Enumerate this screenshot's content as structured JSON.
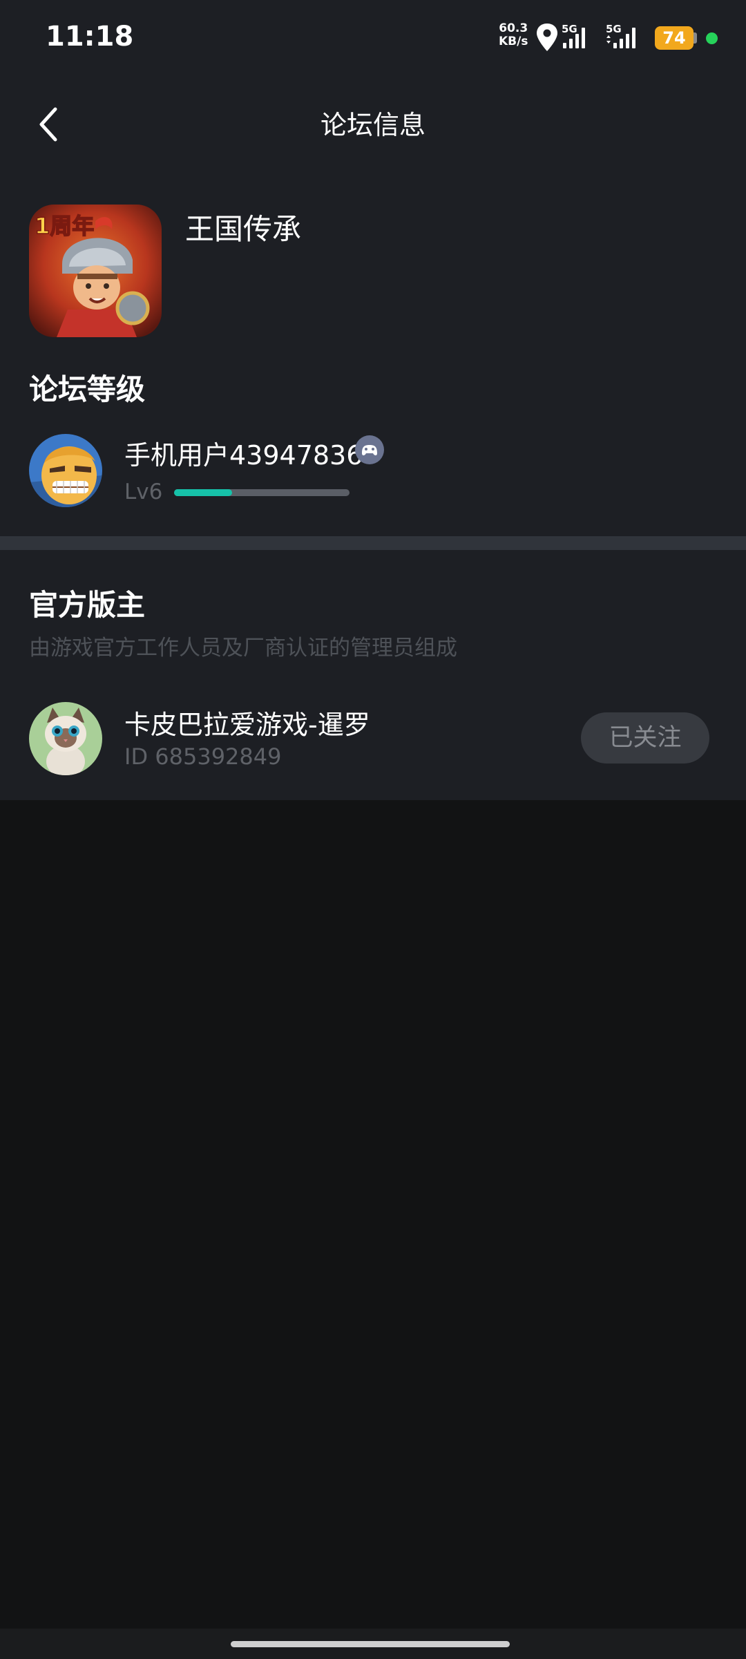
{
  "status_bar": {
    "time": "11:18",
    "net_speed_value": "60.3",
    "net_speed_unit": "KB/s",
    "signal1": "5G",
    "signal2": "5G",
    "battery": "74"
  },
  "header": {
    "title": "论坛信息"
  },
  "game": {
    "name": "王国传承",
    "icon_badge": "1周年"
  },
  "forum_level": {
    "section_title": "论坛等级",
    "user_name": "手机用户43947836",
    "level": "Lv6",
    "progress": 0.33
  },
  "moderators": {
    "section_title": "官方版主",
    "subtitle": "由游戏官方工作人员及厂商认证的管理员组成",
    "items": [
      {
        "name": "卡皮巴拉爱游戏-暹罗",
        "id": "ID 685392849",
        "follow_label": "已关注"
      }
    ]
  },
  "colors": {
    "background": "#121314",
    "card": "#1d1f24",
    "accent": "#16c1a9",
    "battery": "#f2a81d"
  }
}
